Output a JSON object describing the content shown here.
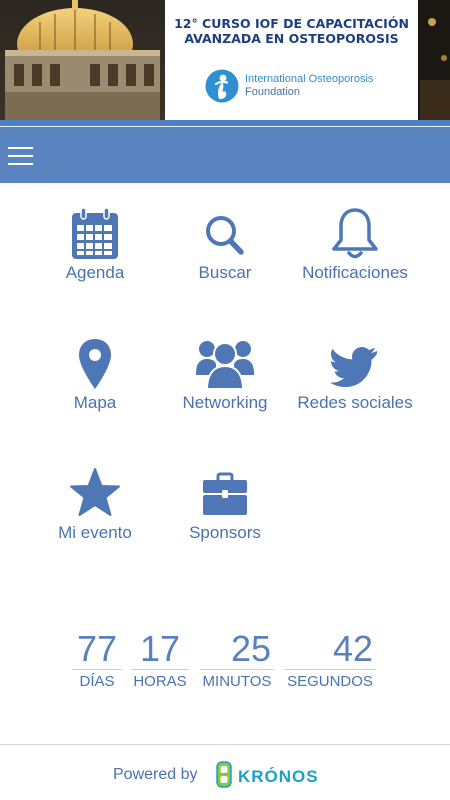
{
  "banner": {
    "course_title_line1": "12° CURSO IOF DE CAPACITACIÓN",
    "course_title_line2": "AVANZADA EN OSTEOPOROSIS",
    "org_name_line1": "International Osteoporosis",
    "org_name_line2": "Foundation"
  },
  "menu": [
    {
      "label": "Agenda",
      "icon": "calendar-icon"
    },
    {
      "label": "Buscar",
      "icon": "search-icon"
    },
    {
      "label": "Notificaciones",
      "icon": "bell-icon"
    },
    {
      "label": "Mapa",
      "icon": "map-pin-icon"
    },
    {
      "label": "Networking",
      "icon": "people-icon"
    },
    {
      "label": "Redes sociales",
      "icon": "twitter-icon"
    },
    {
      "label": "Mi evento",
      "icon": "star-icon"
    },
    {
      "label": "Sponsors",
      "icon": "briefcase-icon"
    }
  ],
  "countdown": {
    "days": {
      "value": "77",
      "label": "DÍAS"
    },
    "hours": {
      "value": "17",
      "label": "HORAS"
    },
    "minutes": {
      "value": "25",
      "label": "MINUTOS"
    },
    "seconds": {
      "value": "42",
      "label": "SEGUNDOS"
    }
  },
  "footer": {
    "powered_by": "Powered by",
    "brand": "KRÓNOS"
  },
  "colors": {
    "accent": "#5a84bf",
    "icon": "#4f77b6",
    "text": "#4a72b2"
  }
}
